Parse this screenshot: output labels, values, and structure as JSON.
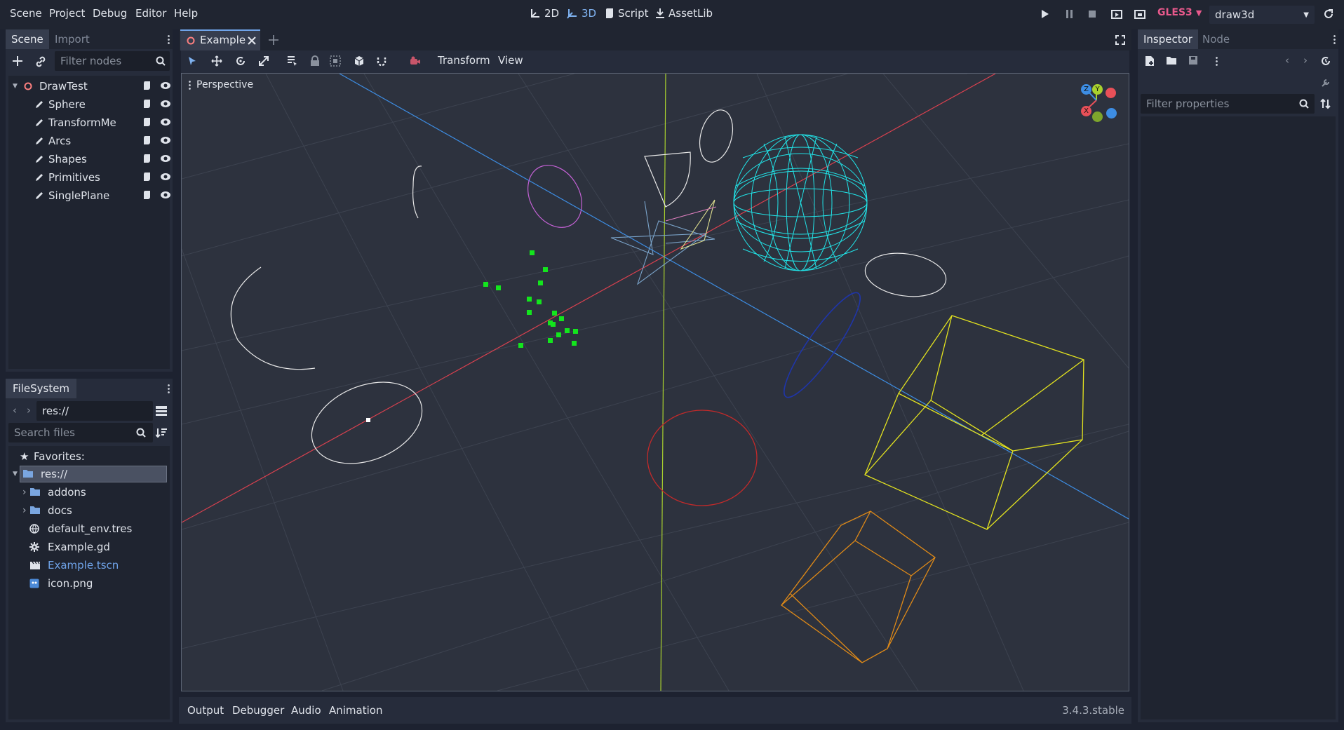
{
  "menu": [
    "Scene",
    "Project",
    "Debug",
    "Editor",
    "Help"
  ],
  "modes": {
    "two_d": "2D",
    "three_d": "3D",
    "script": "Script",
    "assetlib": "AssetLib"
  },
  "renderer": "GLES3",
  "run_config": "draw3d",
  "scene_panel": {
    "tabs": [
      "Scene",
      "Import"
    ],
    "filter_placeholder": "Filter nodes",
    "root": "DrawTest",
    "children": [
      "Sphere",
      "TransformMe",
      "Arcs",
      "Shapes",
      "Primitives",
      "SinglePlane"
    ]
  },
  "filesystem": {
    "title": "FileSystem",
    "path": "res://",
    "search_placeholder": "Search files",
    "favorites": "Favorites:",
    "root": "res://",
    "items": [
      {
        "name": "addons",
        "icon": "folder-icon",
        "color": "#dfe3ea"
      },
      {
        "name": "docs",
        "icon": "folder-icon",
        "color": "#dfe3ea"
      },
      {
        "name": "default_env.tres",
        "icon": "globe-icon",
        "color": "#dfe3ea"
      },
      {
        "name": "Example.gd",
        "icon": "gear-icon",
        "color": "#dfe3ea"
      },
      {
        "name": "Example.tscn",
        "icon": "clapperboard-icon",
        "color": "#6fa3e8"
      },
      {
        "name": "icon.png",
        "icon": "image-icon",
        "color": "#dfe3ea"
      }
    ]
  },
  "editor": {
    "tab": "Example",
    "toolbar": {
      "transform": "Transform",
      "view": "View"
    },
    "viewport_label": "Perspective",
    "gizmo": {
      "x": "X",
      "y": "Y",
      "z": "Z"
    }
  },
  "inspector": {
    "tabs": [
      "Inspector",
      "Node"
    ],
    "filter_placeholder": "Filter properties"
  },
  "bottom": {
    "tabs": [
      "Output",
      "Debugger",
      "Audio",
      "Animation"
    ],
    "version": "3.4.3.stable"
  },
  "colors": {
    "accent": "#6fa3e8",
    "renderer": "#e8598c",
    "grid_red": "#d9414f",
    "grid_blue": "#3d8de3",
    "grid_green": "#a9d12e"
  }
}
